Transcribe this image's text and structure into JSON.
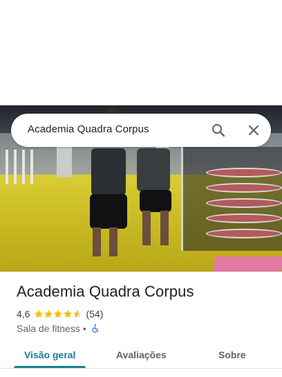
{
  "search": {
    "query": "Academia Quadra Corpus"
  },
  "place": {
    "title": "Academia Quadra Corpus",
    "rating": "4,6",
    "stars": 4.6,
    "review_count": "(54)",
    "category": "Sala de fitness",
    "separator": "•"
  },
  "tabs": [
    {
      "label": "Visão geral",
      "active": true
    },
    {
      "label": "Avaliações",
      "active": false
    },
    {
      "label": "Sobre",
      "active": false
    }
  ],
  "colors": {
    "accent": "#1a7f8e",
    "star": "#fbbc04",
    "wheelchair": "#1a73e8"
  },
  "icons": {
    "search": "search-icon",
    "close": "close-icon",
    "accessibility": "wheelchair-icon",
    "rating": "star-icon"
  }
}
